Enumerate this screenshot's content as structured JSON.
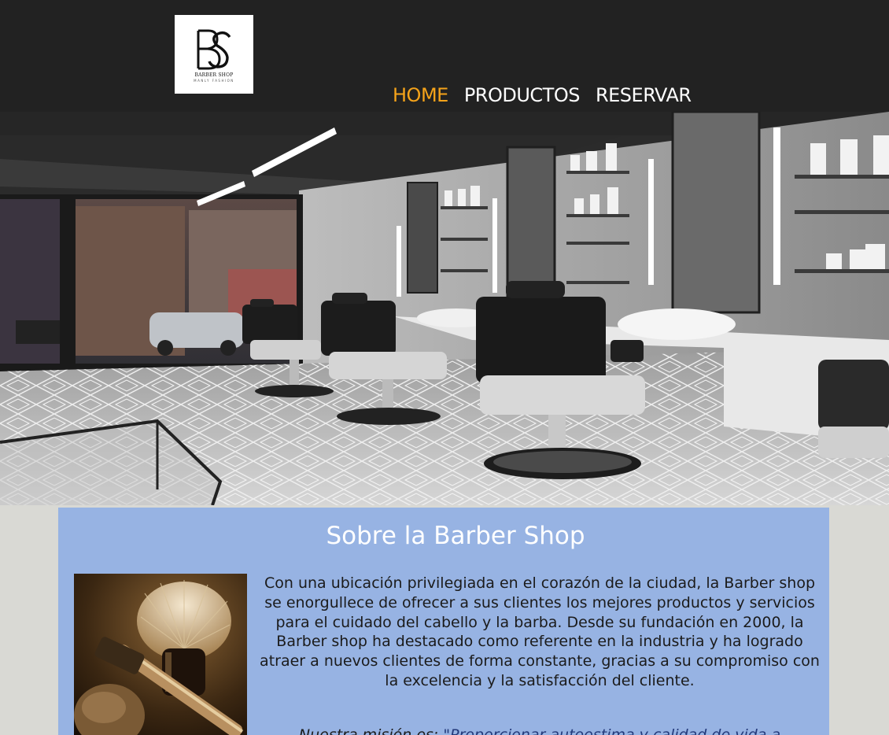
{
  "header": {
    "logo": {
      "monogram": "BS",
      "name": "BARBER SHOP",
      "tagline": "MANLY FASHION"
    },
    "nav": [
      {
        "label": "HOME",
        "active": true
      },
      {
        "label": "PRODUCTOS",
        "active": false
      },
      {
        "label": "RESERVAR",
        "active": false
      }
    ]
  },
  "colors": {
    "header_bg": "#222222",
    "nav_active": "#f5a31a",
    "section_bg": "#97b3e3",
    "page_bg": "#d9d9d4"
  },
  "about": {
    "title": "Sobre la Barber Shop",
    "paragraph": "Con una ubicación privilegiada en el corazón de la ciudad, la Barber shop se enorgullece de ofrecer a sus clientes los mejores productos y servicios para el cuidado del cabello y la barba. Desde su fundación en 2000, la Barber shop ha destacado como referente en la industria y ha logrado atraer a nuevos clientes de forma constante, gracias a su compromiso con la excelencia y la satisfacción del cliente.",
    "mission_prefix": "Nuestra misión es: ",
    "mission_quote": "\"Proporcionar autoestima y calidad de vida a"
  }
}
